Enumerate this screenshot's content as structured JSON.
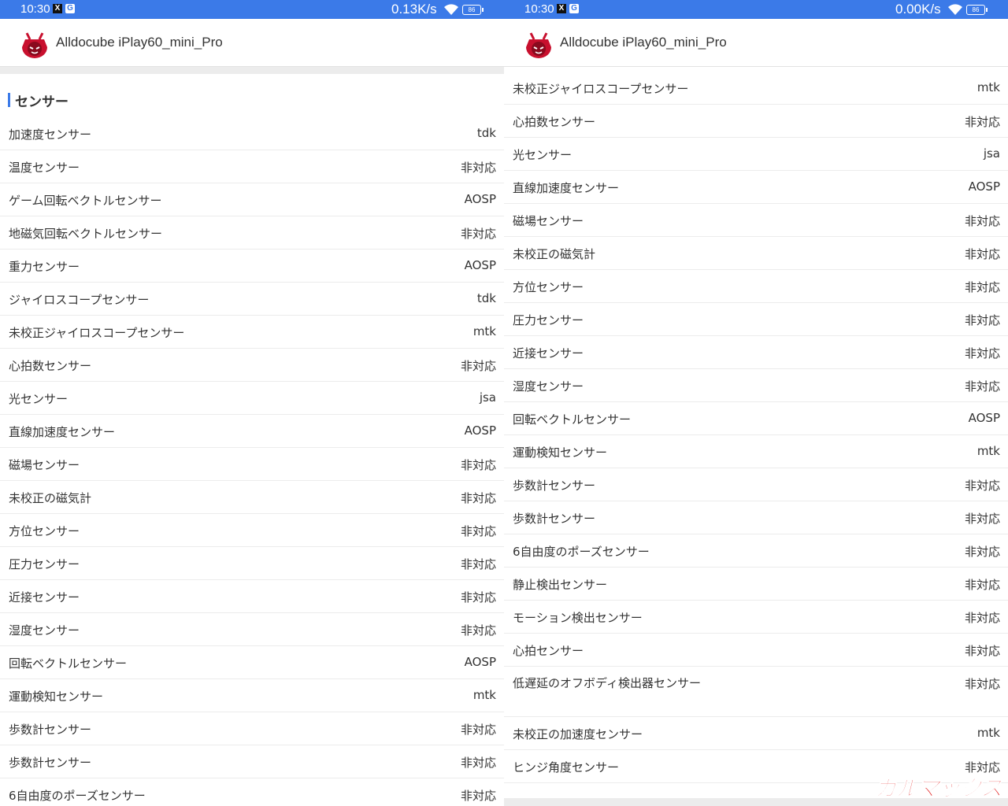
{
  "colors": {
    "accent": "#3b7ae8",
    "watermark": "#e01010"
  },
  "left": {
    "status": {
      "time": "10:30",
      "speed": "0.13K/s",
      "battery": "86"
    },
    "title": "Alldocube iPlay60_mini_Pro",
    "section_title": "センサー",
    "rows": [
      {
        "label": "加速度センサー",
        "value": "tdk"
      },
      {
        "label": "温度センサー",
        "value": "非対応"
      },
      {
        "label": "ゲーム回転ベクトルセンサー",
        "value": "AOSP"
      },
      {
        "label": "地磁気回転ベクトルセンサー",
        "value": "非対応"
      },
      {
        "label": "重力センサー",
        "value": "AOSP"
      },
      {
        "label": "ジャイロスコープセンサー",
        "value": "tdk"
      },
      {
        "label": "未校正ジャイロスコープセンサー",
        "value": "mtk"
      },
      {
        "label": "心拍数センサー",
        "value": "非対応"
      },
      {
        "label": "光センサー",
        "value": "jsa"
      },
      {
        "label": "直線加速度センサー",
        "value": "AOSP"
      },
      {
        "label": "磁場センサー",
        "value": "非対応"
      },
      {
        "label": "未校正の磁気計",
        "value": "非対応"
      },
      {
        "label": "方位センサー",
        "value": "非対応"
      },
      {
        "label": "圧力センサー",
        "value": "非対応"
      },
      {
        "label": "近接センサー",
        "value": "非対応"
      },
      {
        "label": "湿度センサー",
        "value": "非対応"
      },
      {
        "label": "回転ベクトルセンサー",
        "value": "AOSP"
      },
      {
        "label": "運動検知センサー",
        "value": "mtk"
      },
      {
        "label": "歩数計センサー",
        "value": "非対応"
      },
      {
        "label": "歩数計センサー",
        "value": "非対応"
      },
      {
        "label": "6自由度のポーズセンサー",
        "value": "非対応"
      }
    ]
  },
  "right": {
    "status": {
      "time": "10:30",
      "speed": "0.00K/s",
      "battery": "86"
    },
    "title": "Alldocube iPlay60_mini_Pro",
    "rows": [
      {
        "label": "未校正ジャイロスコープセンサー",
        "value": "mtk"
      },
      {
        "label": "心拍数センサー",
        "value": "非対応"
      },
      {
        "label": "光センサー",
        "value": "jsa"
      },
      {
        "label": "直線加速度センサー",
        "value": "AOSP"
      },
      {
        "label": "磁場センサー",
        "value": "非対応"
      },
      {
        "label": "未校正の磁気計",
        "value": "非対応"
      },
      {
        "label": "方位センサー",
        "value": "非対応"
      },
      {
        "label": "圧力センサー",
        "value": "非対応"
      },
      {
        "label": "近接センサー",
        "value": "非対応"
      },
      {
        "label": "湿度センサー",
        "value": "非対応"
      },
      {
        "label": "回転ベクトルセンサー",
        "value": "AOSP"
      },
      {
        "label": "運動検知センサー",
        "value": "mtk"
      },
      {
        "label": "歩数計センサー",
        "value": "非対応"
      },
      {
        "label": "歩数計センサー",
        "value": "非対応"
      },
      {
        "label": "6自由度のポーズセンサー",
        "value": "非対応"
      },
      {
        "label": "静止検出センサー",
        "value": "非対応"
      },
      {
        "label": "モーション検出センサー",
        "value": "非対応"
      },
      {
        "label": "心拍センサー",
        "value": "非対応"
      },
      {
        "label": "低遅延のオフボディ検出器センサー",
        "value": "非対応"
      },
      {
        "label": "未校正の加速度センサー",
        "value": "mtk"
      },
      {
        "label": "ヒンジ角度センサー",
        "value": "非対応"
      }
    ],
    "watermark": "ガルマックス"
  }
}
